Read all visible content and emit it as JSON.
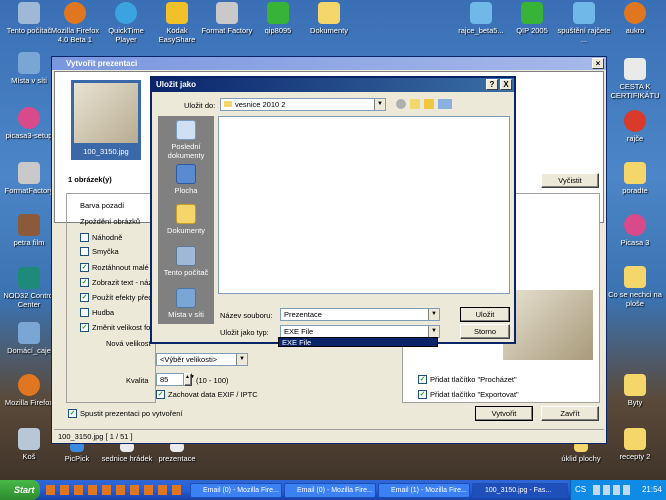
{
  "desktop_left": [
    {
      "label": "Tento počítač"
    },
    {
      "label": "Místa v síti"
    },
    {
      "label": "picasa3-setup"
    },
    {
      "label": "FormatFactory"
    },
    {
      "label": "petra film"
    },
    {
      "label": "NOD32 Control Center"
    },
    {
      "label": "Domácí_caje"
    },
    {
      "label": "Mozilla Firefox"
    },
    {
      "label": "Koš"
    }
  ],
  "desktop_top": [
    {
      "label": "Mozilla Firefox 4.0 Beta 1"
    },
    {
      "label": "QuickTime Player"
    },
    {
      "label": "Kodak EasyShare"
    },
    {
      "label": "Format Factory"
    },
    {
      "label": "qip8095"
    },
    {
      "label": "Dokumenty"
    },
    {
      "label": "rajce_beta5..."
    },
    {
      "label": "QIP 2005"
    },
    {
      "label": "spuštění rajčete ..."
    },
    {
      "label": "aukro"
    }
  ],
  "desktop_right": [
    {
      "label": "CESTA K CERTIFIKÁTU"
    },
    {
      "label": "rajče"
    },
    {
      "label": "poradte"
    },
    {
      "label": "Picasa 3"
    },
    {
      "label": "Co se nechci na ploše"
    },
    {
      "label": "Byty"
    },
    {
      "label": "recepty 2"
    }
  ],
  "desktop_bottom": [
    {
      "label": "PicPick"
    },
    {
      "label": "sednice hrádek"
    },
    {
      "label": "prezentace"
    },
    {
      "label": "úklid plochy"
    }
  ],
  "main_window": {
    "title": "Vytvořit prezentaci",
    "thumbnail_caption": "100_3150.jpg",
    "count_label": "1 obrázek(y)",
    "clear_button": "Vyčistit",
    "options": {
      "bg_color": "Barva pozadí",
      "delay": "Zpoždění obrázků",
      "random": "Náhodně",
      "loop": "Smyčka",
      "stretch": "Roztáhnout malé ob",
      "show_text": "Zobrazit text - název",
      "effects": "Použít efekty přech",
      "music": "Hudba",
      "resize": "Změnit velikost for",
      "new_size": "Nová velikost",
      "size_select": "<Výběr velikosti>",
      "quality_label": "Kvalita",
      "quality_value": "85",
      "quality_range": "(10 - 100)",
      "keep_exif": "Zachovat data EXIF / IPTC",
      "add_prochazet": "Přidat tlačítko \"Procházet\"",
      "add_exportovat": "Přidat tlačítko \"Exportovat\"",
      "start_after": "Spustit prezentaci po vytvoření"
    },
    "create_button": "Vytvořit",
    "close_button": "Zavřít",
    "status": "100_3150.jpg [ 1 / 51 ]"
  },
  "save_dialog": {
    "title": "Uložit jako",
    "save_in_label": "Uložit do:",
    "save_in_value": "vesnice 2010 2",
    "places": [
      {
        "label": "Poslední dokumenty"
      },
      {
        "label": "Plocha"
      },
      {
        "label": "Dokumenty"
      },
      {
        "label": "Tento počítač"
      },
      {
        "label": "Místa v síti"
      }
    ],
    "filename_label": "Název souboru:",
    "filename_value": "Prezentace",
    "filetype_label": "Uložit jako typ:",
    "filetype_value": "EXE File",
    "filetype_option": "EXE File",
    "save_button": "Uložit",
    "cancel_button": "Storno",
    "help_button": "?",
    "close_button": "X"
  },
  "taskbar": {
    "start": "Start",
    "tasks": [
      {
        "label": "Email (0) - Mozilla Fire..."
      },
      {
        "label": "Email (0) - Mozilla Fire..."
      },
      {
        "label": "Email (1) - Mozilla Fire..."
      },
      {
        "label": "100_3150.jpg - Fas..."
      }
    ],
    "lang": "CS",
    "clock": "21:54"
  },
  "colors": {
    "titlebar": "#0a246a",
    "window": "#ece9d8",
    "taskbar": "#245edb",
    "start": "#2e8b2e"
  }
}
